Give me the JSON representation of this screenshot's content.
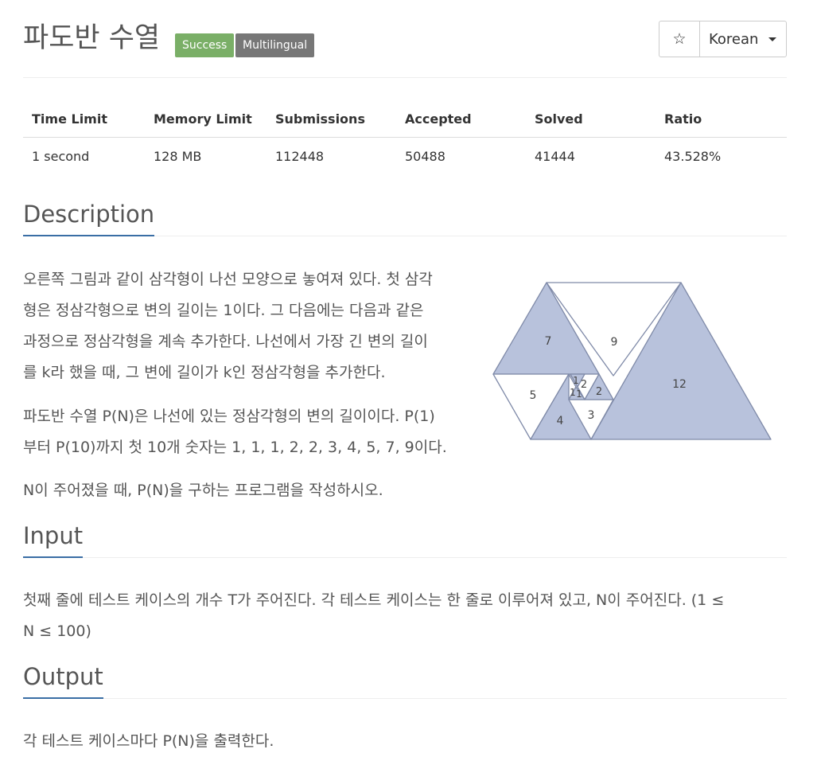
{
  "header": {
    "title": "파도반 수열",
    "badges": [
      "Success",
      "Multilingual"
    ],
    "star_icon": "☆",
    "language": "Korean"
  },
  "stats": {
    "headers": [
      "Time Limit",
      "Memory Limit",
      "Submissions",
      "Accepted",
      "Solved",
      "Ratio"
    ],
    "values": [
      "1 second",
      "128 MB",
      "112448",
      "50488",
      "41444",
      "43.528%"
    ]
  },
  "description": {
    "heading": "Description",
    "lines1": [
      "오른쪽 그림과 같이 삼각형이 나선 모양으로 놓여져 있다. 첫 삼각",
      "형은 정삼각형으로 변의 길이는 1이다. 그 다음에는 다음과 같은",
      "과정으로 정삼각형을 계속 추가한다. 나선에서 가장 긴 변의 길이",
      "를 k라 했을 때, 그 변에 길이가 k인 정삼각형을 추가한다."
    ],
    "lines2": [
      "파도반 수열 P(N)은 나선에 있는 정삼각형의 변의 길이이다. P(1)",
      "부터 P(10)까지 첫 10개 숫자는 1, 1, 1, 2, 2, 3, 4, 5, 7, 9이다."
    ],
    "line3": "N이 주어졌을 때, P(N)을 구하는 프로그램을 작성하시오.",
    "figure_labels": [
      "7",
      "9",
      "12",
      "5",
      "4",
      "3",
      "1",
      "1",
      "1",
      "2",
      "2"
    ]
  },
  "input": {
    "heading": "Input",
    "lines": [
      "첫째 줄에 테스트 케이스의 개수 T가 주어진다. 각 테스트 케이스는 한 줄로 이루어져 있고, N이 주어진다. (1 ≤",
      "N ≤ 100)"
    ]
  },
  "output": {
    "heading": "Output",
    "line": "각 테스트 케이스마다 P(N)을 출력한다."
  },
  "colors": {
    "success": "#7aaf67",
    "multilingual": "#777777",
    "accent": "#3a6ea5",
    "triangle_fill": "#b8c2dc"
  }
}
